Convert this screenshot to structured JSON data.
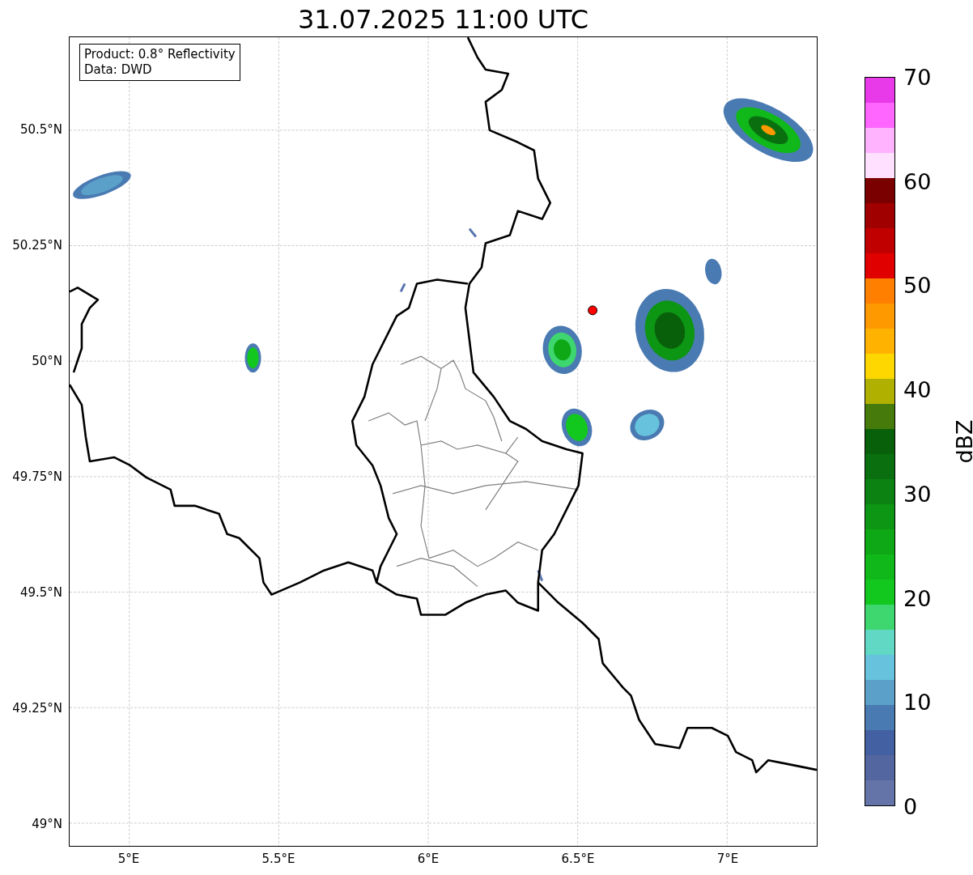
{
  "title": "31.07.2025 11:00 UTC",
  "info_box": {
    "lines": [
      "Product: 0.8° Reflectivity",
      "Data: DWD"
    ]
  },
  "map": {
    "yticks": [
      "50.5°N",
      "50.25°N",
      "50°N",
      "49.75°N",
      "49.5°N",
      "49.25°N",
      "49°N"
    ],
    "xticks": [
      "5°E",
      "5.5°E",
      "6°E",
      "6.5°E",
      "7°E"
    ]
  },
  "colorbar": {
    "label": "dBZ",
    "ticks": [
      "70",
      "60",
      "50",
      "40",
      "30",
      "20",
      "10",
      "0"
    ],
    "bands": [
      {
        "color": "#e93ae9"
      },
      {
        "color": "#ff66ff"
      },
      {
        "color": "#ffb3ff"
      },
      {
        "color": "#ffe0ff"
      },
      {
        "color": "#7a0000"
      },
      {
        "color": "#a00000"
      },
      {
        "color": "#c00000"
      },
      {
        "color": "#e00000"
      },
      {
        "color": "#ff7f00"
      },
      {
        "color": "#ff9900"
      },
      {
        "color": "#ffb300"
      },
      {
        "color": "#ffd700"
      },
      {
        "color": "#b0b000"
      },
      {
        "color": "#467a0a"
      },
      {
        "color": "#08600a"
      },
      {
        "color": "#0a700f"
      },
      {
        "color": "#0b8212"
      },
      {
        "color": "#0d9514"
      },
      {
        "color": "#0ea816"
      },
      {
        "color": "#10b81a"
      },
      {
        "color": "#12c81e"
      },
      {
        "color": "#3ed66e"
      },
      {
        "color": "#60d8c4"
      },
      {
        "color": "#66c2dd"
      },
      {
        "color": "#5aa0c8"
      },
      {
        "color": "#4a7ab2"
      },
      {
        "color": "#4360a2"
      },
      {
        "color": "#5466a0"
      },
      {
        "color": "#6474a8"
      }
    ]
  }
}
